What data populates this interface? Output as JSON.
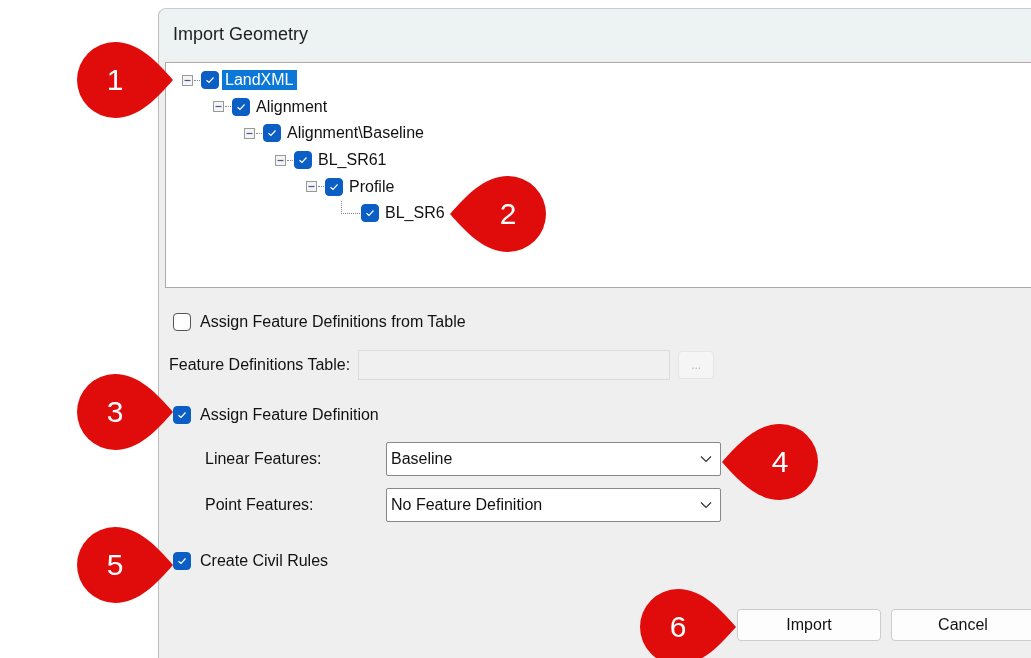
{
  "dialog": {
    "title": "Import Geometry"
  },
  "tree": [
    {
      "label": "LandXML",
      "checked": true,
      "selected": true,
      "expanded": true,
      "children": [
        {
          "label": "Alignment",
          "checked": true,
          "selected": false,
          "expanded": true,
          "children": [
            {
              "label": "Alignment\\Baseline",
              "checked": true,
              "selected": false,
              "expanded": true,
              "children": [
                {
                  "label": "BL_SR61",
                  "checked": true,
                  "selected": false,
                  "expanded": true,
                  "children": [
                    {
                      "label": "Profile",
                      "checked": true,
                      "selected": false,
                      "expanded": true,
                      "children": [
                        {
                          "label": "BL_SR6",
                          "checked": true,
                          "selected": false
                        }
                      ]
                    }
                  ]
                }
              ]
            }
          ]
        }
      ]
    }
  ],
  "from_table": {
    "label": "Assign Feature Definitions from Table",
    "checked": false
  },
  "table_field": {
    "label": "Feature Definitions Table:",
    "browse": "...",
    "disabled": true
  },
  "assign": {
    "label": "Assign Feature Definition",
    "checked": true
  },
  "dropdowns": [
    {
      "label": "Linear Features:",
      "value": "Baseline"
    },
    {
      "label": "Point Features:",
      "value": "No Feature Definition"
    }
  ],
  "civil_rules": {
    "label": "Create Civil Rules",
    "checked": true
  },
  "buttons": [
    "Import",
    "Cancel"
  ],
  "callouts": [
    {
      "number": "1",
      "kind": "right"
    },
    {
      "number": "2",
      "kind": "left"
    },
    {
      "number": "3",
      "kind": "right"
    },
    {
      "number": "4",
      "kind": "left"
    },
    {
      "number": "5",
      "kind": "right"
    },
    {
      "number": "6",
      "kind": "right"
    }
  ]
}
